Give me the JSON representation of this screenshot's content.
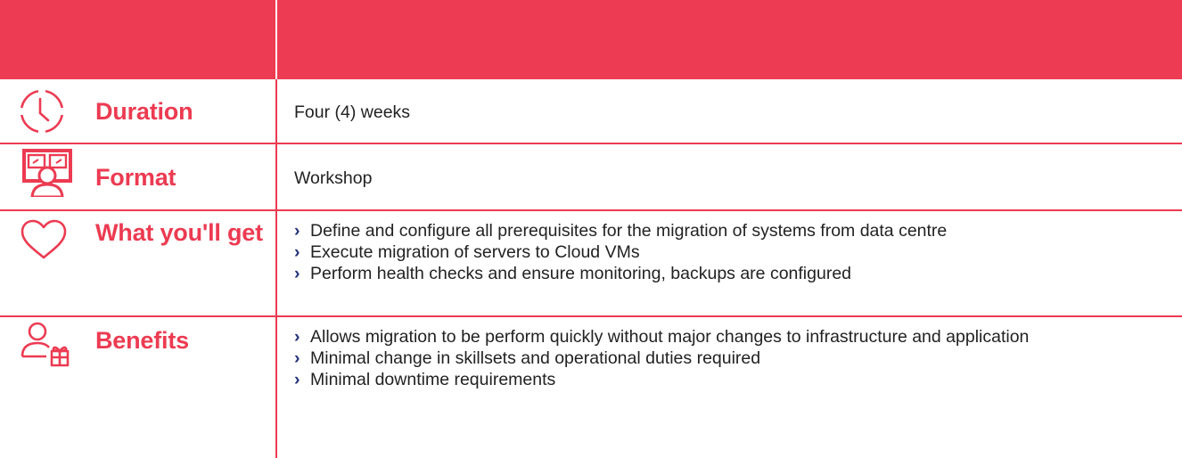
{
  "colors": {
    "accent": "#ec3b52",
    "bullet": "#24337a",
    "text": "#222222"
  },
  "rows": [
    {
      "label": "Duration",
      "icon": "clock-icon",
      "value": "Four (4) weeks"
    },
    {
      "label": "Format",
      "icon": "workshop-icon",
      "value": "Workshop"
    },
    {
      "label": "What you'll get",
      "icon": "heart-icon",
      "bullets": [
        "Define and configure all prerequisites for the migration of systems from data centre",
        "Execute migration of servers to Cloud VMs",
        "Perform health checks and ensure monitoring, backups are configured"
      ]
    },
    {
      "label": "Benefits",
      "icon": "user-gift-icon",
      "bullets": [
        "Allows migration to be perform quickly without major changes to infrastructure and application",
        "Minimal change in skillsets and operational duties required",
        "Minimal downtime requirements"
      ]
    }
  ],
  "bullet_glyph": "›"
}
